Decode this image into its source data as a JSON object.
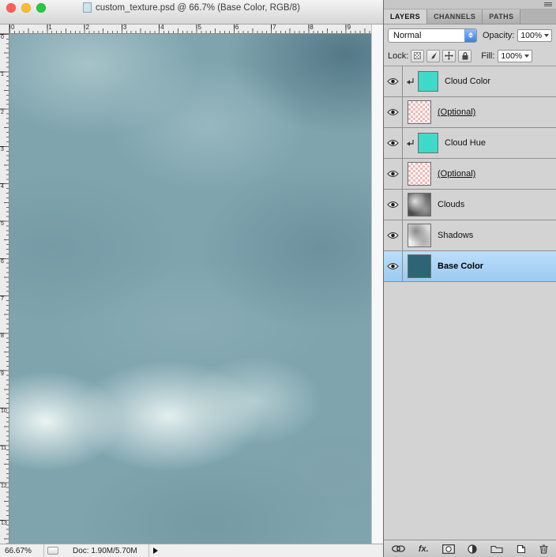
{
  "window": {
    "title": "custom_texture.psd @ 66.7% (Base Color, RGB/8)"
  },
  "status_bar": {
    "zoom": "66.67%",
    "doc_info": "Doc: 1.90M/5.70M"
  },
  "rulers": {
    "horizontal": [
      "0",
      "1",
      "2",
      "3",
      "4",
      "5",
      "6",
      "7",
      "8",
      "9"
    ],
    "vertical": [
      "0",
      "1",
      "2",
      "3",
      "4",
      "5",
      "6",
      "7",
      "8",
      "9",
      "10",
      "11",
      "12",
      "13"
    ]
  },
  "panel": {
    "tabs": [
      {
        "label": "LAYERS"
      },
      {
        "label": "CHANNELS"
      },
      {
        "label": "PATHS"
      }
    ],
    "blend_mode_value": "Normal",
    "opacity_label": "Opacity:",
    "opacity_value": "100%",
    "lock_label": "Lock:",
    "fill_label": "Fill:",
    "fill_value": "100%",
    "fx_label": "fx.",
    "layers": [
      {
        "name": "Cloud Color",
        "clipped": true,
        "thumb": "teal",
        "visible": true
      },
      {
        "name": "(Optional)",
        "underline": true,
        "thumb": "checker",
        "visible": true
      },
      {
        "name": "Cloud Hue",
        "clipped": true,
        "thumb": "teal",
        "visible": true
      },
      {
        "name": "(Optional)",
        "underline": true,
        "thumb": "checker",
        "visible": true
      },
      {
        "name": "Clouds",
        "thumb": "clouds",
        "visible": true
      },
      {
        "name": "Shadows",
        "thumb": "shadows",
        "visible": true
      },
      {
        "name": "Base Color",
        "thumb": "base",
        "visible": true,
        "selected": true
      }
    ]
  },
  "colors": {
    "selection_highlight": "#a9d3f6",
    "teal_swatch": "#3fd9c9",
    "base_color_swatch": "#2e6574",
    "canvas_base": "#7fa4ae"
  }
}
